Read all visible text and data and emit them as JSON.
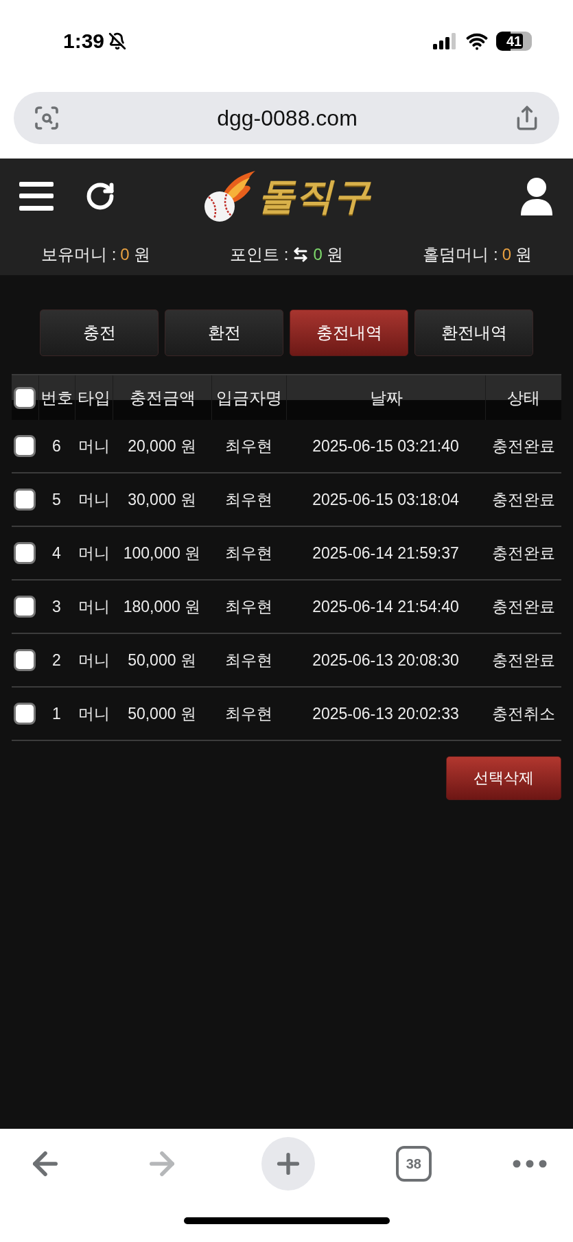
{
  "status_bar": {
    "time": "1:39",
    "battery": "41"
  },
  "browser": {
    "url": "dgg-0088.com",
    "tab_count": "38"
  },
  "header": {
    "logo": "돌직구"
  },
  "balances": [
    {
      "kind": "money",
      "label": "보유머니 :",
      "amount": "0",
      "unit": "원"
    },
    {
      "kind": "points",
      "label": "포인트 :",
      "amount": "0",
      "unit": "원"
    },
    {
      "kind": "money",
      "label": "홀덤머니 :",
      "amount": "0",
      "unit": "원"
    }
  ],
  "tabs": [
    {
      "label": "충전",
      "selected": false
    },
    {
      "label": "환전",
      "selected": false
    },
    {
      "label": "충전내역",
      "selected": true
    },
    {
      "label": "환전내역",
      "selected": false
    }
  ],
  "table": {
    "select_all": {
      "checked": false
    },
    "columns": [
      "번호",
      "타입",
      "충전금액",
      "입금자명",
      "날짜",
      "상태"
    ],
    "rows": [
      {
        "checked": false,
        "cells": [
          "6",
          "머니",
          "20,000 원",
          "최우현",
          "2025-06-15 03:21:40",
          "충전완료"
        ]
      },
      {
        "checked": false,
        "cells": [
          "5",
          "머니",
          "30,000 원",
          "최우현",
          "2025-06-15 03:18:04",
          "충전완료"
        ]
      },
      {
        "checked": false,
        "cells": [
          "4",
          "머니",
          "100,000 원",
          "최우현",
          "2025-06-14 21:59:37",
          "충전완료"
        ]
      },
      {
        "checked": false,
        "cells": [
          "3",
          "머니",
          "180,000 원",
          "최우현",
          "2025-06-14 21:54:40",
          "충전완료"
        ]
      },
      {
        "checked": false,
        "cells": [
          "2",
          "머니",
          "50,000 원",
          "최우현",
          "2025-06-13 20:08:30",
          "충전완료"
        ]
      },
      {
        "checked": false,
        "cells": [
          "1",
          "머니",
          "50,000 원",
          "최우현",
          "2025-06-13 20:02:33",
          "충전취소"
        ]
      }
    ]
  },
  "delete_button": "선택삭제"
}
